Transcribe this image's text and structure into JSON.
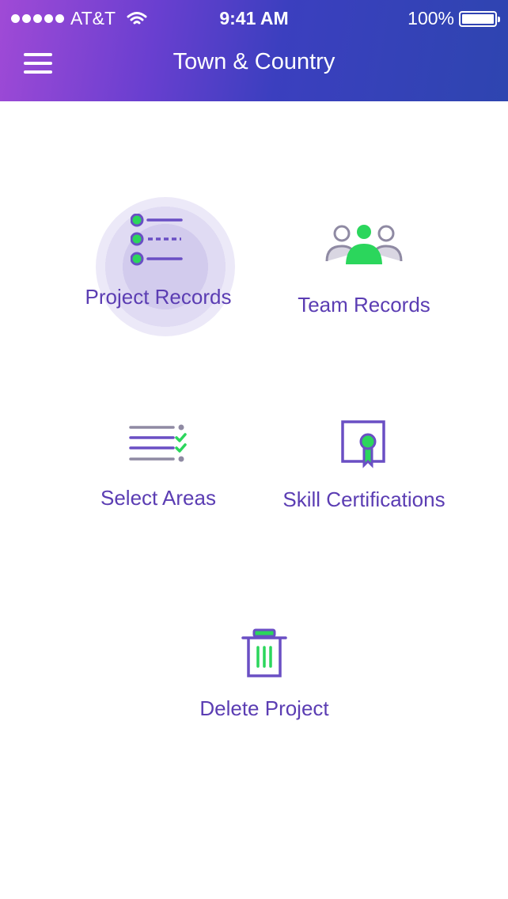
{
  "status_bar": {
    "carrier": "AT&T",
    "time": "9:41 AM",
    "battery": "100%",
    "signal_icon": "signal-dots-icon",
    "wifi_icon": "wifi-icon",
    "battery_icon": "battery-icon"
  },
  "nav": {
    "title": "Town & Country",
    "menu_icon": "hamburger-menu-icon"
  },
  "menu": {
    "items": [
      {
        "label": "Project Records",
        "icon": "list-records-icon"
      },
      {
        "label": "Team Records",
        "icon": "team-people-icon"
      },
      {
        "label": "Select Areas",
        "icon": "checklist-icon"
      },
      {
        "label": "Skill Certifications",
        "icon": "certificate-icon"
      },
      {
        "label": "Delete Project",
        "icon": "trash-icon"
      }
    ]
  },
  "colors": {
    "accent": "#5b3db3",
    "green": "#2bd65c",
    "gray": "#8f8aa3",
    "header_gradient_start": "#a04ad6",
    "header_gradient_end": "#2e45b0"
  }
}
